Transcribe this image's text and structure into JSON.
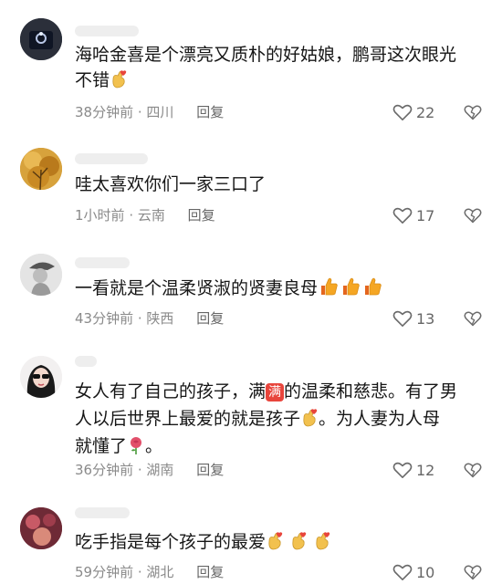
{
  "comments": [
    {
      "text_parts": [
        "海哈金喜是个漂亮又质朴的好姑娘，鹏哥这次眼光",
        "不错"
      ],
      "emoji": "heart-hand",
      "time": "38分钟前",
      "region": "四川",
      "reply": "回复",
      "likes": "22"
    },
    {
      "text": "哇太喜欢你们一家三口了",
      "time": "1小时前",
      "region": "云南",
      "reply": "回复",
      "likes": "17"
    },
    {
      "text": "一看就是个温柔贤淑的贤妻良母",
      "emoji": "thumbs-up",
      "time": "43分钟前",
      "region": "陕西",
      "reply": "回复",
      "likes": "13"
    },
    {
      "line1_a": "女人有了自己的孩子，满",
      "badge": "满",
      "line1_b": "的温柔和慈悲。有了男",
      "line2_a": "人以后世界上最爱的就是孩子",
      "line2_b": "。为人妻为人母",
      "line3_a": "就懂了",
      "line3_b": "。",
      "time": "36分钟前",
      "region": "湖南",
      "reply": "回复",
      "likes": "12"
    },
    {
      "text": "吃手指是每个孩子的最爱",
      "emoji": "heart-hand",
      "time": "59分钟前",
      "region": "湖北",
      "reply": "回复",
      "likes": "10"
    }
  ],
  "separator": " · ",
  "colors": {
    "text": "#161616",
    "meta": "#8a8a8a",
    "badge": "#e8453c",
    "thumb": "#f5a623",
    "heart_hand": "#f2c14e"
  }
}
